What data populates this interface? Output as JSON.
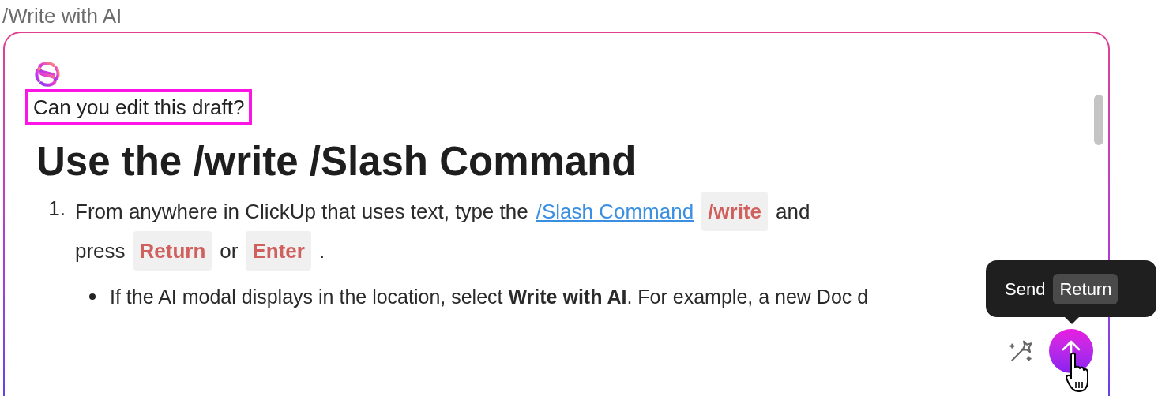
{
  "page_title": "/Write with AI",
  "prompt": "Can you edit this draft?",
  "heading": "Use the /write /Slash Command",
  "steps": [
    {
      "number": "1.",
      "lines": [
        [
          {
            "kind": "text",
            "text": "From anywhere in ClickUp that uses text, type the"
          },
          {
            "kind": "link",
            "text": "/Slash Command"
          },
          {
            "kind": "code",
            "text": "/write"
          },
          {
            "kind": "text",
            "text": "and"
          }
        ],
        [
          {
            "kind": "text",
            "text": "press"
          },
          {
            "kind": "code",
            "text": "Return"
          },
          {
            "kind": "text",
            "text": "or"
          },
          {
            "kind": "code",
            "text": "Enter"
          },
          {
            "kind": "text",
            "text": "."
          }
        ]
      ],
      "bullets": [
        "If the AI modal displays in the location, select **Write with AI**. For example, a new Doc d"
      ]
    }
  ],
  "tooltip": {
    "label": "Send",
    "key": "Return"
  }
}
